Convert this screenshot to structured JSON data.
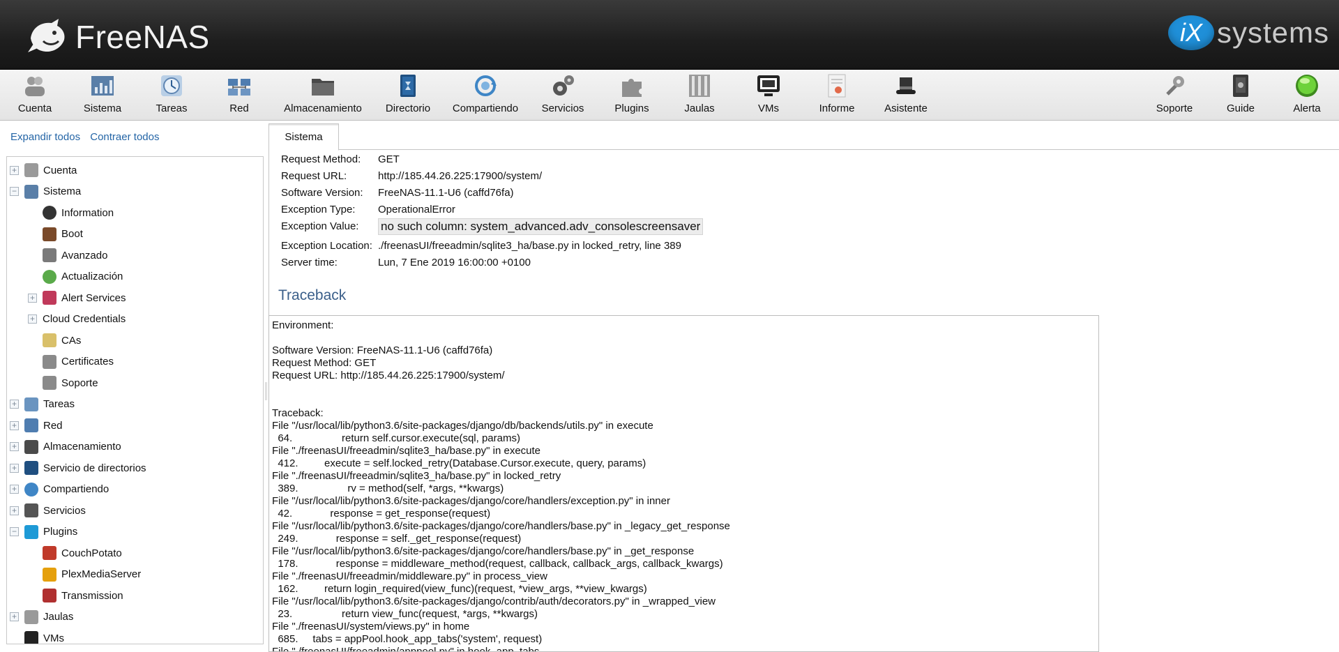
{
  "header": {
    "app_name": "FreeNAS",
    "vendor_mark": "iX",
    "vendor_name": "systems"
  },
  "toolbar": {
    "left_items": [
      {
        "label": "Cuenta",
        "icon": "users-icon"
      },
      {
        "label": "Sistema",
        "icon": "system-chart-icon"
      },
      {
        "label": "Tareas",
        "icon": "clock-icon"
      },
      {
        "label": "Red",
        "icon": "network-icon"
      },
      {
        "label": "Almacenamiento",
        "icon": "folder-icon"
      },
      {
        "label": "Directorio",
        "icon": "directory-book-icon"
      },
      {
        "label": "Compartiendo",
        "icon": "sharing-icon"
      },
      {
        "label": "Servicios",
        "icon": "gears-icon"
      },
      {
        "label": "Plugins",
        "icon": "puzzle-icon"
      },
      {
        "label": "Jaulas",
        "icon": "jail-bars-icon"
      },
      {
        "label": "VMs",
        "icon": "monitor-icon"
      },
      {
        "label": "Informe",
        "icon": "report-icon"
      },
      {
        "label": "Asistente",
        "icon": "wizard-hat-icon"
      }
    ],
    "right_items": [
      {
        "label": "Soporte",
        "icon": "support-icon"
      },
      {
        "label": "Guide",
        "icon": "guide-book-icon"
      },
      {
        "label": "Alerta",
        "icon": "alert-light-icon"
      }
    ]
  },
  "sidebar": {
    "expand_all": "Expandir todos",
    "collapse_all": "Contraer todos",
    "tree": [
      {
        "label": "Cuenta",
        "level": 0,
        "expander": "+",
        "icon": "users-icon"
      },
      {
        "label": "Sistema",
        "level": 0,
        "expander": "−",
        "icon": "system-chart-icon"
      },
      {
        "label": "Information",
        "level": 1,
        "expander": "",
        "icon": "info-icon"
      },
      {
        "label": "Boot",
        "level": 1,
        "expander": "",
        "icon": "boot-icon"
      },
      {
        "label": "Avanzado",
        "level": 1,
        "expander": "",
        "icon": "wrench-icon"
      },
      {
        "label": "Actualización",
        "level": 1,
        "expander": "",
        "icon": "update-icon"
      },
      {
        "label": "Alert Services",
        "level": 1,
        "expander": "+",
        "icon": "alert-services-icon"
      },
      {
        "label": "Cloud Credentials",
        "level": 1,
        "expander": "+",
        "icon": ""
      },
      {
        "label": "CAs",
        "level": 1,
        "expander": "",
        "icon": "certificate-authority-icon"
      },
      {
        "label": "Certificates",
        "level": 1,
        "expander": "",
        "icon": "certificate-icon"
      },
      {
        "label": "Soporte",
        "level": 1,
        "expander": "",
        "icon": "support-icon"
      },
      {
        "label": "Tareas",
        "level": 0,
        "expander": "+",
        "icon": "clock-icon"
      },
      {
        "label": "Red",
        "level": 0,
        "expander": "+",
        "icon": "network-icon"
      },
      {
        "label": "Almacenamiento",
        "level": 0,
        "expander": "+",
        "icon": "folder-icon"
      },
      {
        "label": "Servicio de directorios",
        "level": 0,
        "expander": "+",
        "icon": "directory-book-icon"
      },
      {
        "label": "Compartiendo",
        "level": 0,
        "expander": "+",
        "icon": "sharing-icon"
      },
      {
        "label": "Servicios",
        "level": 0,
        "expander": "+",
        "icon": "gears-icon"
      },
      {
        "label": "Plugins",
        "level": 0,
        "expander": "−",
        "icon": "puzzle-icon"
      },
      {
        "label": "CouchPotato",
        "level": 1,
        "expander": "",
        "icon": "couchpotato-icon"
      },
      {
        "label": "PlexMediaServer",
        "level": 1,
        "expander": "",
        "icon": "plex-icon"
      },
      {
        "label": "Transmission",
        "level": 1,
        "expander": "",
        "icon": "transmission-icon"
      },
      {
        "label": "Jaulas",
        "level": 0,
        "expander": "+",
        "icon": "jail-bars-icon"
      },
      {
        "label": "VMs",
        "level": 0,
        "expander": "",
        "icon": "monitor-icon"
      }
    ]
  },
  "main": {
    "tab_label": "Sistema",
    "request_info": [
      {
        "key": "Request Method:",
        "value": "GET",
        "boxed": false
      },
      {
        "key": "Request URL:",
        "value": "http://185.44.26.225:17900/system/",
        "boxed": false
      },
      {
        "key": "Software Version:",
        "value": "FreeNAS-11.1-U6 (caffd76fa)",
        "boxed": false
      },
      {
        "key": "Exception Type:",
        "value": "OperationalError",
        "boxed": false
      },
      {
        "key": "Exception Value:",
        "value": "no such column: system_advanced.adv_consolescreensaver",
        "boxed": true
      },
      {
        "key": "Exception Location:",
        "value": "./freenasUI/freeadmin/sqlite3_ha/base.py in locked_retry, line 389",
        "boxed": false
      },
      {
        "key": "Server time:",
        "value": "Lun, 7 Ene 2019 16:00:00 +0100",
        "boxed": false
      }
    ],
    "traceback_title": "Traceback",
    "traceback_text": "Environment:\n\nSoftware Version: FreeNAS-11.1-U6 (caffd76fa)\nRequest Method: GET\nRequest URL: http://185.44.26.225:17900/system/\n\n\nTraceback:\nFile \"/usr/local/lib/python3.6/site-packages/django/db/backends/utils.py\" in execute\n  64.                 return self.cursor.execute(sql, params)\nFile \"./freenasUI/freeadmin/sqlite3_ha/base.py\" in execute\n  412.         execute = self.locked_retry(Database.Cursor.execute, query, params)\nFile \"./freenasUI/freeadmin/sqlite3_ha/base.py\" in locked_retry\n  389.                 rv = method(self, *args, **kwargs)\nFile \"/usr/local/lib/python3.6/site-packages/django/core/handlers/exception.py\" in inner\n  42.             response = get_response(request)\nFile \"/usr/local/lib/python3.6/site-packages/django/core/handlers/base.py\" in _legacy_get_response\n  249.             response = self._get_response(request)\nFile \"/usr/local/lib/python3.6/site-packages/django/core/handlers/base.py\" in _get_response\n  178.             response = middleware_method(request, callback, callback_args, callback_kwargs)\nFile \"./freenasUI/freeadmin/middleware.py\" in process_view\n  162.         return login_required(view_func)(request, *view_args, **view_kwargs)\nFile \"/usr/local/lib/python3.6/site-packages/django/contrib/auth/decorators.py\" in _wrapped_view\n  23.                 return view_func(request, *args, **kwargs)\nFile \"./freenasUI/system/views.py\" in home\n  685.     tabs = appPool.hook_app_tabs('system', request)\nFile \"./freenasUI/freeadmin/apppool.py\" in hook_app_tabs"
  }
}
